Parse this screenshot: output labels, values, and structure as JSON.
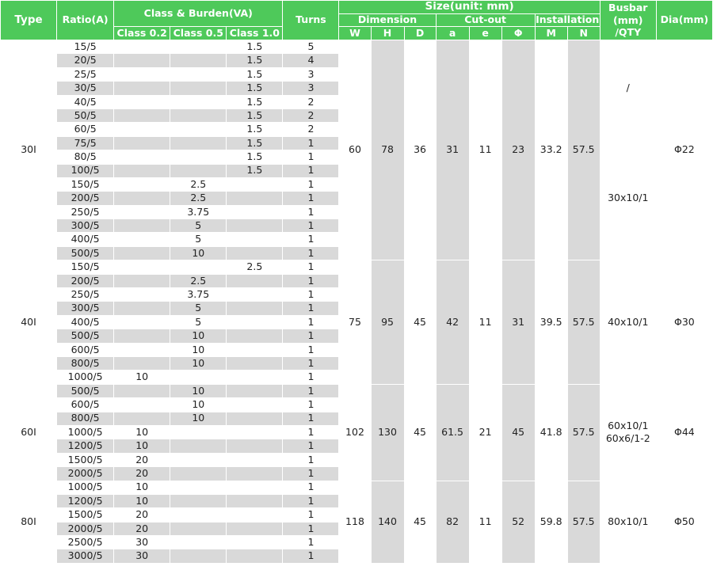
{
  "headers": {
    "type": "Type",
    "ratio": "Ratio(A)",
    "class_burden": "Class & Burden(VA)",
    "turns": "Turns",
    "size": "Size(unit: mm)",
    "busbar": "Busbar (mm) /QTY",
    "dia": "Dia(mm)",
    "dimension": "Dimension",
    "cutout": "Cut-out",
    "installation": "Installation",
    "class_02": "Class 0.2",
    "class_05": "Class 0.5",
    "class_10": "Class 1.0",
    "w": "W",
    "h": "H",
    "d": "D",
    "a": "a",
    "e": "e",
    "phi": "Φ",
    "m": "M",
    "n": "N"
  },
  "groups": [
    {
      "type": "30I",
      "w": "60",
      "h": "78",
      "d": "36",
      "a": "31",
      "e": "11",
      "phi": "23",
      "m": "33.2",
      "n": "57.5",
      "dia": "Φ22",
      "busbar": [
        {
          "text": "/",
          "rows": 7
        },
        {
          "text": "30x10/1",
          "rows": 9
        }
      ],
      "rows": [
        {
          "ratio": "15/5",
          "c02": "",
          "c05": "",
          "c10": "1.5",
          "turns": "5"
        },
        {
          "ratio": "20/5",
          "c02": "",
          "c05": "",
          "c10": "1.5",
          "turns": "4"
        },
        {
          "ratio": "25/5",
          "c02": "",
          "c05": "",
          "c10": "1.5",
          "turns": "3"
        },
        {
          "ratio": "30/5",
          "c02": "",
          "c05": "",
          "c10": "1.5",
          "turns": "3"
        },
        {
          "ratio": "40/5",
          "c02": "",
          "c05": "",
          "c10": "1.5",
          "turns": "2"
        },
        {
          "ratio": "50/5",
          "c02": "",
          "c05": "",
          "c10": "1.5",
          "turns": "2"
        },
        {
          "ratio": "60/5",
          "c02": "",
          "c05": "",
          "c10": "1.5",
          "turns": "2"
        },
        {
          "ratio": "75/5",
          "c02": "",
          "c05": "",
          "c10": "1.5",
          "turns": "1"
        },
        {
          "ratio": "80/5",
          "c02": "",
          "c05": "",
          "c10": "1.5",
          "turns": "1"
        },
        {
          "ratio": "100/5",
          "c02": "",
          "c05": "",
          "c10": "1.5",
          "turns": "1"
        },
        {
          "ratio": "150/5",
          "c02": "",
          "c05": "2.5",
          "c10": "",
          "turns": "1"
        },
        {
          "ratio": "200/5",
          "c02": "",
          "c05": "2.5",
          "c10": "",
          "turns": "1"
        },
        {
          "ratio": "250/5",
          "c02": "",
          "c05": "3.75",
          "c10": "",
          "turns": "1"
        },
        {
          "ratio": "300/5",
          "c02": "",
          "c05": "5",
          "c10": "",
          "turns": "1"
        },
        {
          "ratio": "400/5",
          "c02": "",
          "c05": "5",
          "c10": "",
          "turns": "1"
        },
        {
          "ratio": "500/5",
          "c02": "",
          "c05": "10",
          "c10": "",
          "turns": "1"
        }
      ]
    },
    {
      "type": "40I",
      "w": "75",
      "h": "95",
      "d": "45",
      "a": "42",
      "e": "11",
      "phi": "31",
      "m": "39.5",
      "n": "57.5",
      "dia": "Φ30",
      "busbar": [
        {
          "text": "40x10/1",
          "rows": 9
        }
      ],
      "rows": [
        {
          "ratio": "150/5",
          "c02": "",
          "c05": "",
          "c10": "2.5",
          "turns": "1"
        },
        {
          "ratio": "200/5",
          "c02": "",
          "c05": "2.5",
          "c10": "",
          "turns": "1"
        },
        {
          "ratio": "250/5",
          "c02": "",
          "c05": "3.75",
          "c10": "",
          "turns": "1"
        },
        {
          "ratio": "300/5",
          "c02": "",
          "c05": "5",
          "c10": "",
          "turns": "1"
        },
        {
          "ratio": "400/5",
          "c02": "",
          "c05": "5",
          "c10": "",
          "turns": "1"
        },
        {
          "ratio": "500/5",
          "c02": "",
          "c05": "10",
          "c10": "",
          "turns": "1"
        },
        {
          "ratio": "600/5",
          "c02": "",
          "c05": "10",
          "c10": "",
          "turns": "1"
        },
        {
          "ratio": "800/5",
          "c02": "",
          "c05": "10",
          "c10": "",
          "turns": "1"
        },
        {
          "ratio": "1000/5",
          "c02": "10",
          "c05": "",
          "c10": "",
          "turns": "1"
        }
      ]
    },
    {
      "type": "60I",
      "w": "102",
      "h": "130",
      "d": "45",
      "a": "61.5",
      "e": "21",
      "phi": "45",
      "m": "41.8",
      "n": "57.5",
      "dia": "Φ44",
      "busbar": [
        {
          "text": "60x10/1 60x6/1-2",
          "rows": 7
        }
      ],
      "rows": [
        {
          "ratio": "500/5",
          "c02": "",
          "c05": "10",
          "c10": "",
          "turns": "1"
        },
        {
          "ratio": "600/5",
          "c02": "",
          "c05": "10",
          "c10": "",
          "turns": "1"
        },
        {
          "ratio": "800/5",
          "c02": "",
          "c05": "10",
          "c10": "",
          "turns": "1"
        },
        {
          "ratio": "1000/5",
          "c02": "10",
          "c05": "",
          "c10": "",
          "turns": "1"
        },
        {
          "ratio": "1200/5",
          "c02": "10",
          "c05": "",
          "c10": "",
          "turns": "1"
        },
        {
          "ratio": "1500/5",
          "c02": "20",
          "c05": "",
          "c10": "",
          "turns": "1"
        },
        {
          "ratio": "2000/5",
          "c02": "20",
          "c05": "",
          "c10": "",
          "turns": "1"
        }
      ]
    },
    {
      "type": "80I",
      "w": "118",
      "h": "140",
      "d": "45",
      "a": "82",
      "e": "11",
      "phi": "52",
      "m": "59.8",
      "n": "57.5",
      "dia": "Φ50",
      "busbar": [
        {
          "text": "80x10/1",
          "rows": 6
        }
      ],
      "rows": [
        {
          "ratio": "1000/5",
          "c02": "10",
          "c05": "",
          "c10": "",
          "turns": "1"
        },
        {
          "ratio": "1200/5",
          "c02": "10",
          "c05": "",
          "c10": "",
          "turns": "1"
        },
        {
          "ratio": "1500/5",
          "c02": "20",
          "c05": "",
          "c10": "",
          "turns": "1"
        },
        {
          "ratio": "2000/5",
          "c02": "20",
          "c05": "",
          "c10": "",
          "turns": "1"
        },
        {
          "ratio": "2500/5",
          "c02": "30",
          "c05": "",
          "c10": "",
          "turns": "1"
        },
        {
          "ratio": "3000/5",
          "c02": "30",
          "c05": "",
          "c10": "",
          "turns": "1"
        }
      ]
    }
  ]
}
